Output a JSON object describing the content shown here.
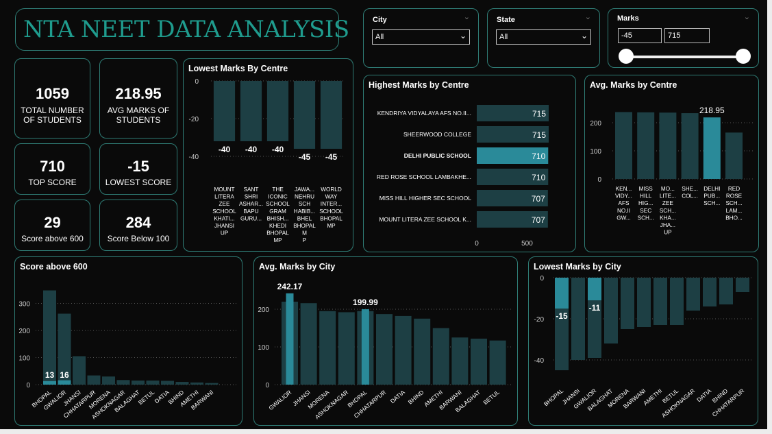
{
  "header": {
    "title": "NTA NEET DATA ANALYSIS"
  },
  "kpis": [
    {
      "value": "1059",
      "label": "TOTAL NUMBER OF STUDENTS"
    },
    {
      "value": "218.95",
      "label": "AVG MARKS OF STUDENTS"
    },
    {
      "value": "710",
      "label": "TOP SCORE"
    },
    {
      "value": "-15",
      "label": "LOWEST SCORE"
    },
    {
      "value": "29",
      "label": "Score above 600"
    },
    {
      "value": "284",
      "label": "Score Below 100"
    }
  ],
  "filters": {
    "city": {
      "label": "City",
      "value": "All"
    },
    "state": {
      "label": "State",
      "value": "All"
    },
    "marks": {
      "label": "Marks",
      "min": "-45",
      "max": "715"
    }
  },
  "colors": {
    "bar_dark": "#1d3f44",
    "bar_highlight": "#2a8a99",
    "border": "#2f7d76",
    "title": "#1f9c8e"
  },
  "icons": {
    "dropdown": "chevron-down-icon",
    "collapse": "chevron-icon"
  },
  "chart_data": [
    {
      "id": "lowest_by_centre",
      "type": "bar",
      "title": "Lowest Marks By Centre",
      "categories": [
        "MOUNT LITERA ZEE SCHOOL KHATI... JHANSI UP",
        "SANT SHRI ASHAR... BAPU GURU...",
        "THE ICONIC SCHOOL GRAM BHISH... KHEDI BHOPAL MP",
        "JAWA... NEHRU SCH HABIB... BHEL BHOPAL M P",
        "WORLD WAY INTER... SCHOOL BHOPAL MP"
      ],
      "values": [
        -40,
        -40,
        -40,
        -45,
        -45
      ],
      "data_labels": [
        "-40",
        "-40",
        "-40",
        "-45",
        "-45"
      ],
      "yticks": [
        "0",
        "-20",
        "-40"
      ],
      "ylim": [
        -50,
        0
      ]
    },
    {
      "id": "highest_by_centre",
      "type": "bar",
      "orientation": "horizontal",
      "title": "Highest Marks by Centre",
      "categories": [
        "KENDRIYA VIDYALAYA AFS NO.II...",
        "SHEERWOOD COLLEGE",
        "DELHI PUBLIC SCHOOL",
        "RED ROSE SCHOOL LAMBAKHE...",
        "MISS HILL HIGHER SEC SCHOOL",
        "MOUNT LITERA ZEE SCHOOL K..."
      ],
      "values": [
        715,
        715,
        710,
        710,
        707,
        707
      ],
      "data_labels": [
        "715",
        "715",
        "710",
        "710",
        "707",
        "707"
      ],
      "highlight": [
        2
      ],
      "xticks": [
        "0",
        "500"
      ],
      "xlim": [
        0,
        715
      ]
    },
    {
      "id": "avg_by_centre",
      "type": "bar",
      "title": "Avg. Marks by Centre",
      "categories": [
        "KEN... VIDY... AFS NO.II GW...",
        "MISS HILL HIG... SEC SCH...",
        "MO... LITE... ZEE SCH... KHA... JHA... UP",
        "SHE... COL...",
        "DELHI PUB... SCH...",
        "RED ROSE SCH... LAM... BHO..."
      ],
      "values": [
        238,
        237,
        236,
        234,
        218.95,
        165
      ],
      "highlight": [
        4
      ],
      "data_labels": [
        "",
        "",
        "",
        "",
        "218.95",
        ""
      ],
      "yticks": [
        "200",
        "100",
        "0"
      ],
      "ylim": [
        0,
        260
      ]
    },
    {
      "id": "score_above_600",
      "type": "bar",
      "title": "Score above 600",
      "categories": [
        "BHOPAL",
        "GWALIOR",
        "JHANSI",
        "CHHATARPUR",
        "MORENA",
        "ASHOKNAGAR",
        "BALAGHAT",
        "BETUL",
        "DATIA",
        "BHIND",
        "AMETHI",
        "BARWANI"
      ],
      "series": [
        {
          "values": [
            348,
            262,
            105,
            34,
            30,
            17,
            15,
            15,
            14,
            10,
            8,
            6
          ]
        },
        {
          "values": [
            13,
            16
          ]
        }
      ],
      "data_labels": [
        "13",
        "16"
      ],
      "yticks": [
        "300",
        "200",
        "100",
        "0"
      ],
      "ylim": [
        0,
        370
      ]
    },
    {
      "id": "avg_by_city",
      "type": "bar",
      "title": "Avg. Marks by City",
      "categories": [
        "GWALIOR",
        "JHANSI",
        "MORENA",
        "ASHOKNAGAR",
        "BHOPAL",
        "CHHATARPUR",
        "DATIA",
        "BHIND",
        "AMETHI",
        "BARWANI",
        "BALAGHAT",
        "BETUL"
      ],
      "series": [
        {
          "values": [
            220,
            216,
            195,
            192,
            195,
            187,
            182,
            175,
            150,
            125,
            122,
            117
          ]
        },
        {
          "values": [
            242.17,
            0,
            0,
            0,
            199.99
          ]
        }
      ],
      "data_labels": [
        "242.17",
        "199.99"
      ],
      "yticks": [
        "200",
        "100",
        "0"
      ],
      "ylim": [
        0,
        270
      ]
    },
    {
      "id": "lowest_by_city",
      "type": "bar",
      "title": "Lowest Marks by City",
      "categories": [
        "BHOPAL",
        "JHANSI",
        "GWALIOR",
        "BALAGHAT",
        "MORENA",
        "BARWANI",
        "AMETHI",
        "BETUL",
        "ASHOKNAGAR",
        "DATIA",
        "BHIND",
        "CHHATARPUR"
      ],
      "series": [
        {
          "values": [
            -45,
            -40,
            -39,
            -32,
            -25,
            -24,
            -23,
            -23,
            -16,
            -14,
            -13,
            -7
          ]
        },
        {
          "values": [
            -15,
            0,
            -11
          ]
        }
      ],
      "data_labels": [
        "-15",
        "-11"
      ],
      "yticks": [
        "0",
        "-20",
        "-40"
      ],
      "ylim": [
        -50,
        0
      ]
    }
  ]
}
